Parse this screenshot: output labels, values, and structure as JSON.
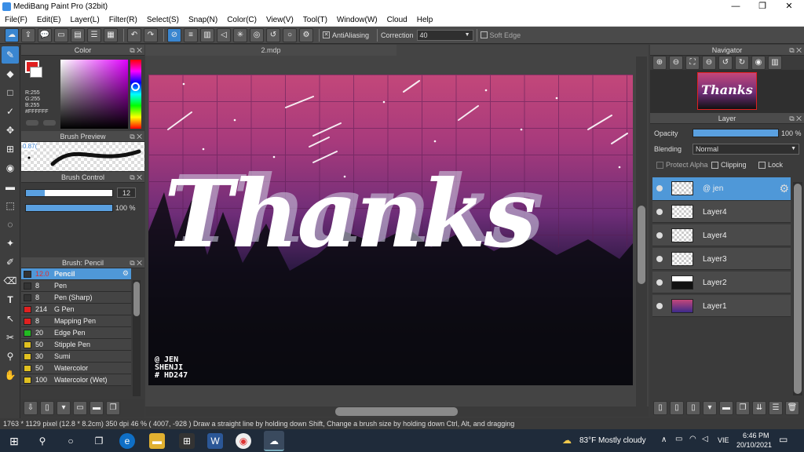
{
  "app": {
    "title": "MediBang Paint Pro (32bit)"
  },
  "menu": [
    "File(F)",
    "Edit(E)",
    "Layer(L)",
    "Filter(R)",
    "Select(S)",
    "Snap(N)",
    "Color(C)",
    "View(V)",
    "Tool(T)",
    "Window(W)",
    "Cloud",
    "Help"
  ],
  "toolbar": {
    "antialiasing_label": "AntiAliasing",
    "correction_label": "Correction",
    "correction_value": "40",
    "soft_edge_label": "Soft Edge"
  },
  "document": {
    "tab": "2.mdp",
    "art_text": "Thanks",
    "credit_text": "@ JEN\nSHENJI\n# HD247"
  },
  "color_panel": {
    "title": "Color",
    "r": "R:255",
    "g": "G:255",
    "b": "B:255",
    "hex": "#FFFFFF",
    "colors": {
      "primary": "#e02020",
      "secondary": "#ffffff"
    }
  },
  "brush_preview": {
    "title": "Brush Preview",
    "size": "0.87("
  },
  "brush_control": {
    "title": "Brush Control",
    "size_value": "12",
    "opacity_value": "100 %",
    "size_fraction": 0.22,
    "opacity_fraction": 1.0
  },
  "brush_list": {
    "title": "Brush: Pencil",
    "items": [
      {
        "size": "12.0",
        "name": "Pencil",
        "color": "#333333"
      },
      {
        "size": "8",
        "name": "Pen",
        "color": "#333333"
      },
      {
        "size": "8",
        "name": "Pen (Sharp)",
        "color": "#333333"
      },
      {
        "size": "214",
        "name": "G Pen",
        "color": "#e02020"
      },
      {
        "size": "8",
        "name": "Mapping Pen",
        "color": "#e02020"
      },
      {
        "size": "20",
        "name": "Edge Pen",
        "color": "#22bb22"
      },
      {
        "size": "50",
        "name": "Stipple Pen",
        "color": "#e0c020"
      },
      {
        "size": "30",
        "name": "Sumi",
        "color": "#e0c020"
      },
      {
        "size": "50",
        "name": "Watercolor",
        "color": "#e0c020"
      },
      {
        "size": "100",
        "name": "Watercolor (Wet)",
        "color": "#e0c020"
      }
    ]
  },
  "navigator": {
    "title": "Navigator",
    "thumb_text": "Thanks"
  },
  "layer_panel": {
    "title": "Layer",
    "opacity_label": "Opacity",
    "opacity_value": "100 %",
    "opacity_fraction": 1.0,
    "blending_label": "Blending",
    "blending_value": "Normal",
    "protect_alpha_label": "Protect Alpha",
    "clipping_label": "Clipping",
    "lock_label": "Lock",
    "layers": [
      "@ jen",
      "Layer4",
      "Layer4",
      "Layer3",
      "Layer2",
      "Layer1"
    ]
  },
  "status": {
    "text": "1763 * 1129 pixel  (12.8 * 8.2cm)  350 dpi  46 %  ( 4007, -928 )  Draw a straight line by holding down Shift, Change a brush size by holding down Ctrl, Alt, and dragging"
  },
  "taskbar": {
    "weather": "83°F  Mostly cloudy",
    "lang": "VIE",
    "time": "6:46 PM",
    "date": "20/10/2021"
  }
}
